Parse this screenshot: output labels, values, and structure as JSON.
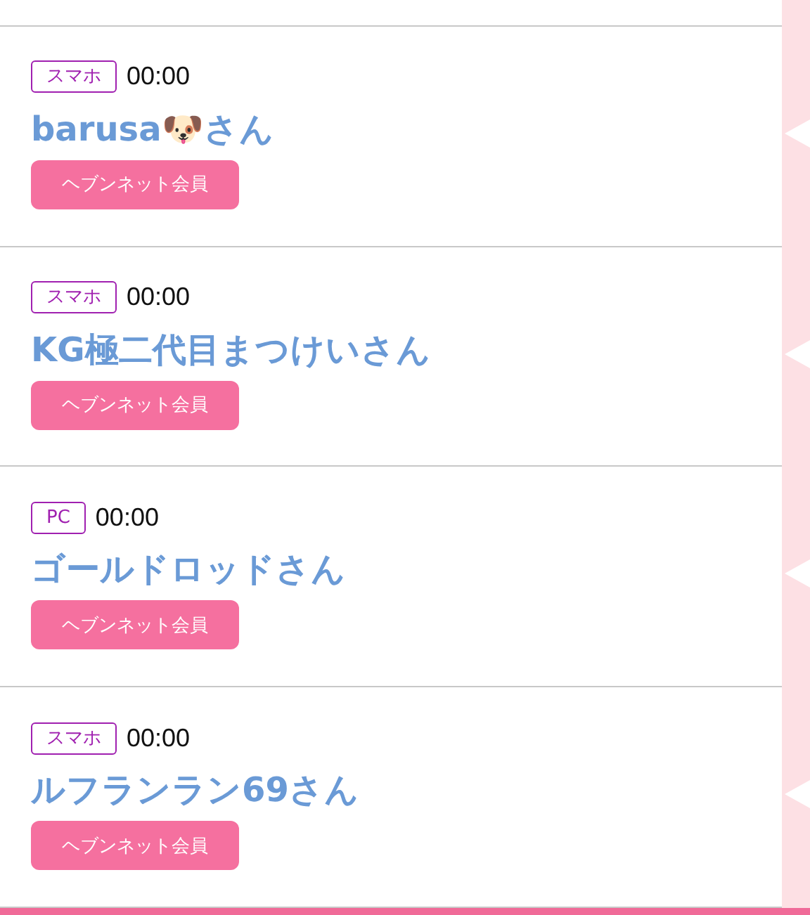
{
  "entries": [
    {
      "device": "スマホ",
      "time": "00:00",
      "name": "barusa🐶さん",
      "member": "ヘブンネット会員"
    },
    {
      "device": "スマホ",
      "time": "00:00",
      "name": "KG極二代目まつけいさん",
      "member": "ヘブンネット会員"
    },
    {
      "device": "PC",
      "time": "00:00",
      "name": "ゴールドロッドさん",
      "member": "ヘブンネット会員"
    },
    {
      "device": "スマホ",
      "time": "00:00",
      "name": "ルフランラン69さん",
      "member": "ヘブンネット会員"
    }
  ]
}
